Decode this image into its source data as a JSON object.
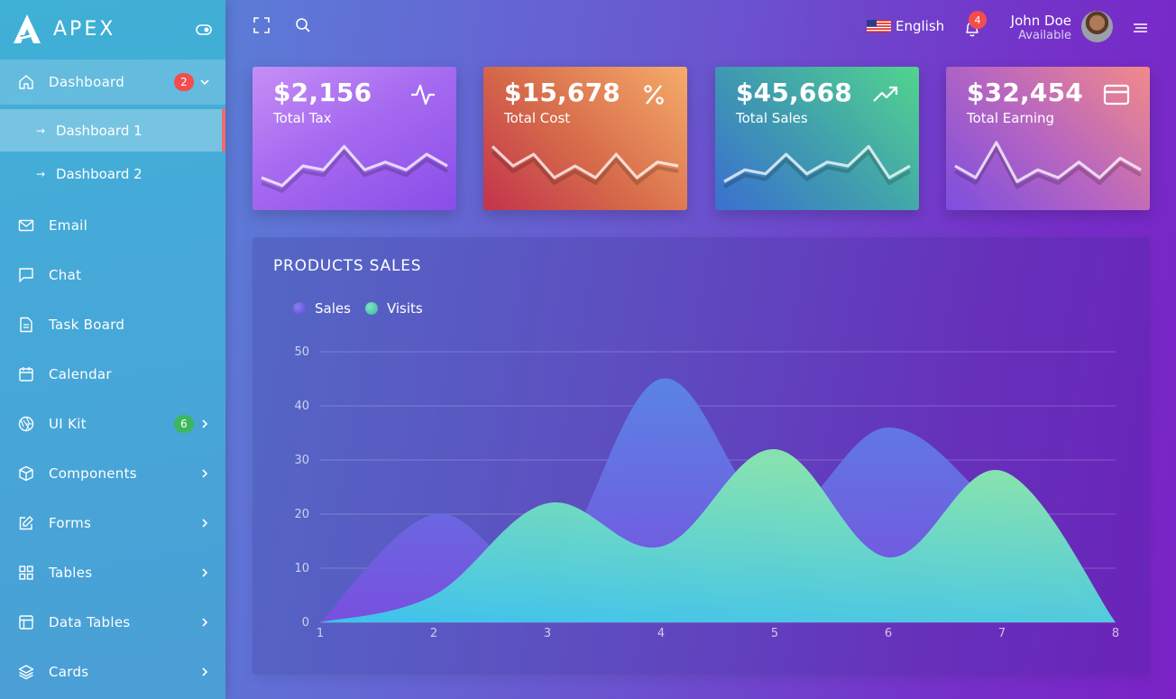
{
  "brand": {
    "name": "APEX"
  },
  "sidebar": {
    "items": [
      {
        "label": "Dashboard",
        "icon": "home-icon",
        "badge": "2",
        "open": true
      },
      {
        "label": "Email",
        "icon": "mail-icon"
      },
      {
        "label": "Chat",
        "icon": "message-icon"
      },
      {
        "label": "Task Board",
        "icon": "file-text-icon"
      },
      {
        "label": "Calendar",
        "icon": "calendar-icon"
      },
      {
        "label": "UI Kit",
        "icon": "aperture-icon",
        "badge": "6"
      },
      {
        "label": "Components",
        "icon": "box-icon"
      },
      {
        "label": "Forms",
        "icon": "edit-icon"
      },
      {
        "label": "Tables",
        "icon": "grid-icon"
      },
      {
        "label": "Data Tables",
        "icon": "layout-icon"
      },
      {
        "label": "Cards",
        "icon": "layers-icon"
      }
    ],
    "subitems": [
      {
        "label": "Dashboard 1",
        "active": true
      },
      {
        "label": "Dashboard 2",
        "active": false
      }
    ]
  },
  "header": {
    "language": "English",
    "notifications": "4",
    "user_name": "John Doe",
    "user_status": "Available"
  },
  "cards": [
    {
      "value": "$2,156",
      "label": "Total Tax",
      "icon": "activity-icon",
      "spark": [
        3,
        1,
        6,
        5,
        11,
        5,
        7,
        5,
        9,
        6
      ]
    },
    {
      "value": "$15,678",
      "label": "Total Cost",
      "icon": "percent-icon",
      "spark": [
        11,
        6,
        9,
        3,
        6,
        3,
        9,
        3,
        7,
        6
      ]
    },
    {
      "value": "$45,668",
      "label": "Total Sales",
      "icon": "trending-up-icon",
      "spark": [
        2,
        5,
        4,
        9,
        4,
        7,
        6,
        11,
        3,
        6
      ]
    },
    {
      "value": "$32,454",
      "label": "Total Earning",
      "icon": "credit-card-icon",
      "spark": [
        6,
        3,
        12,
        2,
        5,
        3,
        7,
        3,
        8,
        5
      ]
    }
  ],
  "colors": {
    "sales": "#6a5ae0",
    "visits": "#5fd9b4",
    "badge_red": "#f44d4d",
    "badge_green": "#3cb85c"
  },
  "chart_data": {
    "type": "area",
    "title": "PRODUCTS SALES",
    "x": [
      1,
      2,
      3,
      4,
      5,
      6,
      7,
      8
    ],
    "series": [
      {
        "name": "Sales",
        "values": [
          0,
          20,
          10,
          45,
          20,
          36,
          20,
          0
        ]
      },
      {
        "name": "Visits",
        "values": [
          0,
          5,
          22,
          14,
          32,
          12,
          28,
          0
        ]
      }
    ],
    "ylim": [
      0,
      50
    ],
    "yticks": [
      0,
      10,
      20,
      30,
      40,
      50
    ],
    "xticks": [
      1,
      2,
      3,
      4,
      5,
      6,
      7,
      8
    ],
    "grid": true,
    "legend": "top-left"
  }
}
